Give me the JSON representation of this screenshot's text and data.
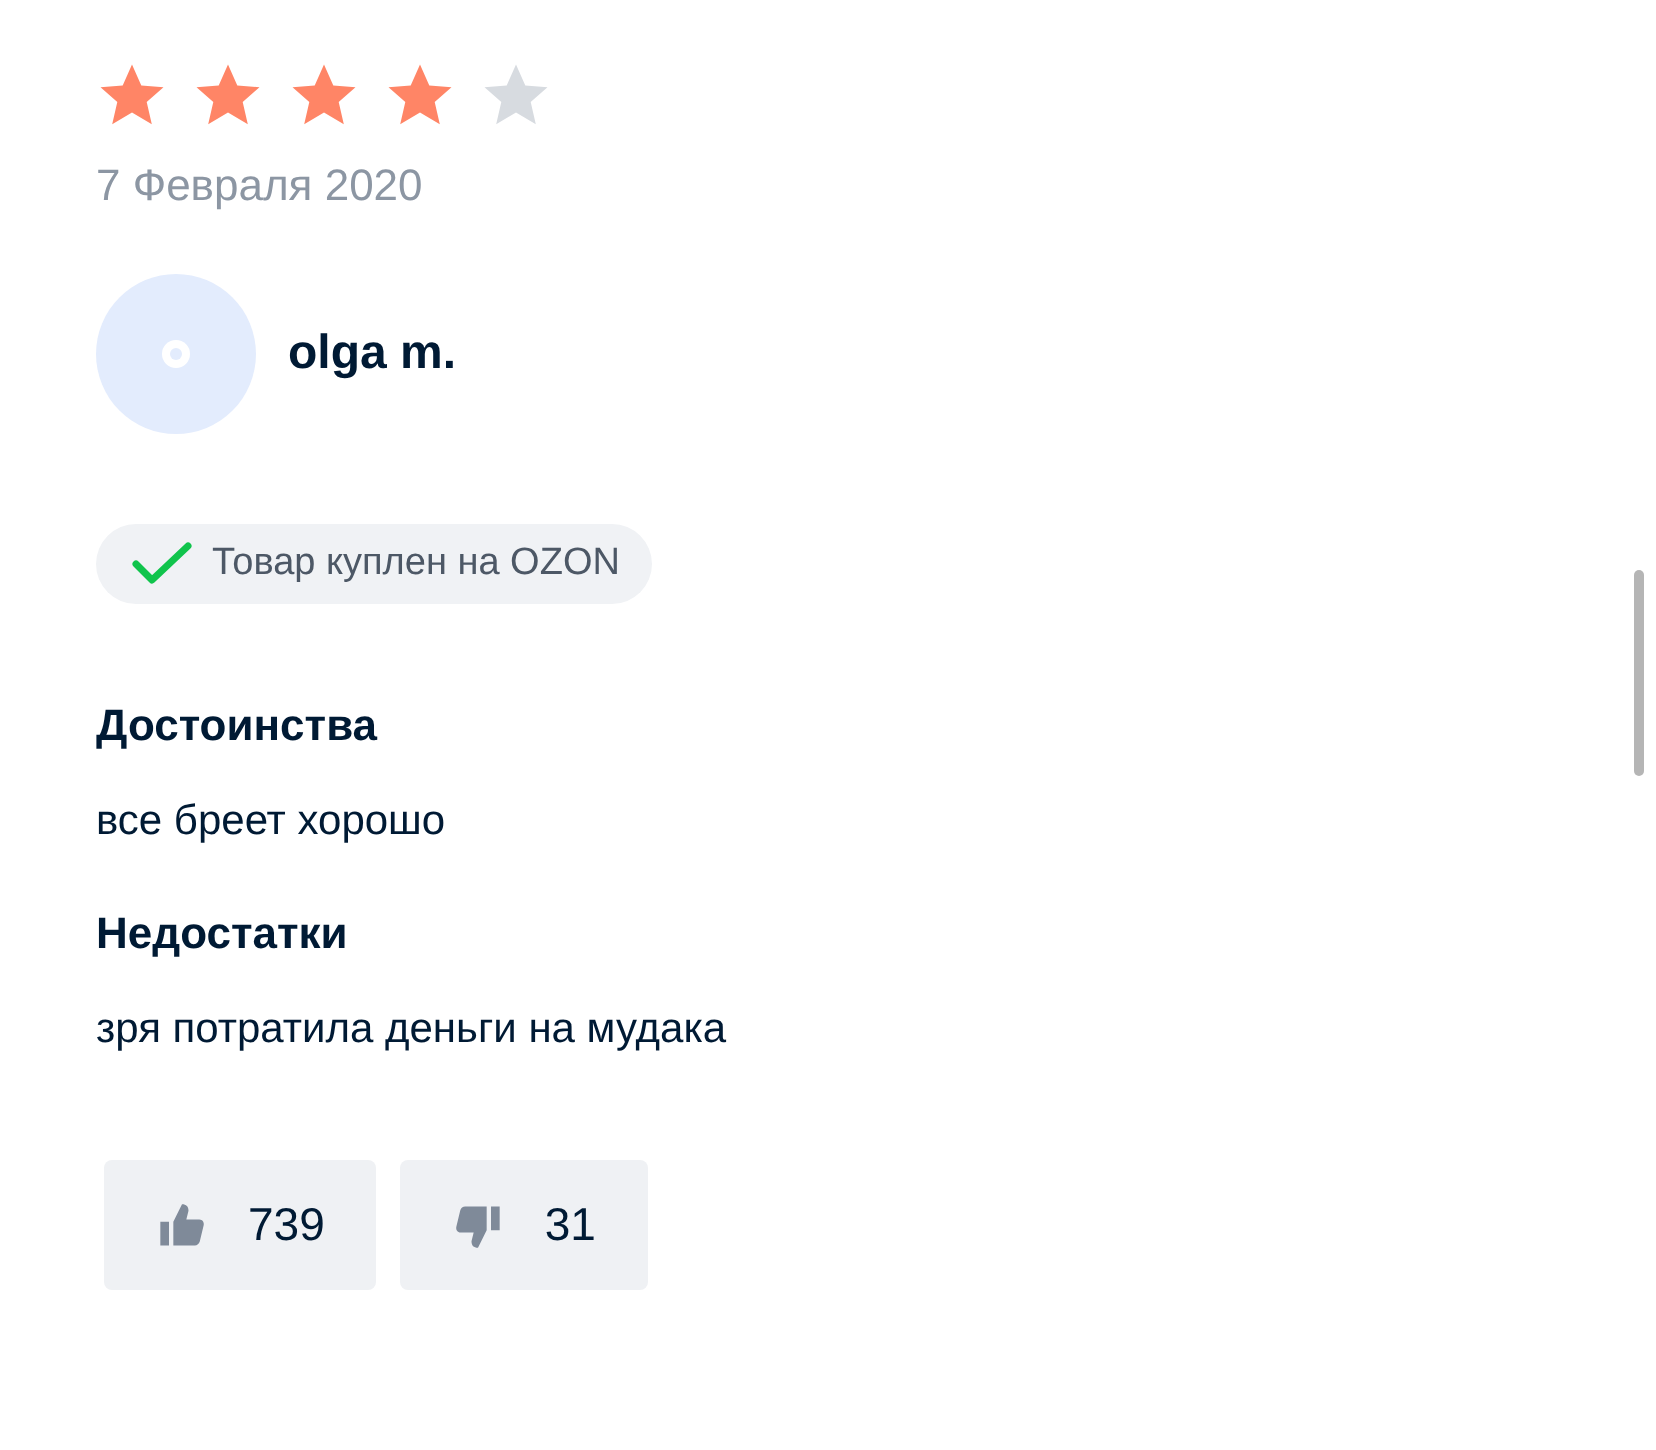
{
  "review": {
    "stars": 4,
    "date": "7 Февраля 2020",
    "author": "olga m.",
    "badge": "Товар куплен на OZON",
    "sections": [
      {
        "title": "Достоинства",
        "text": "все бреет хорошо"
      },
      {
        "title": "Недостатки",
        "text": "зря потратила деньги на мудака"
      }
    ],
    "votes": [
      {
        "kind": "like",
        "count": "739"
      },
      {
        "kind": "dislike",
        "count": "31"
      }
    ]
  }
}
